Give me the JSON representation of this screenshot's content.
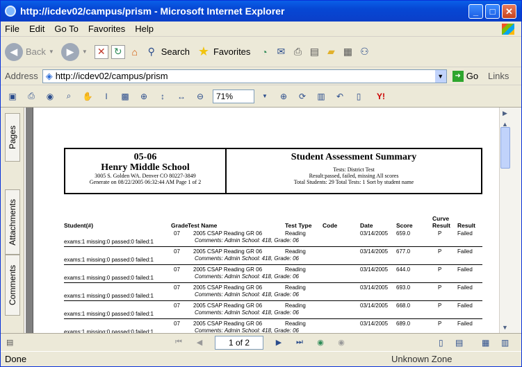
{
  "window": {
    "title": "http://icdev02/campus/prism - Microsoft Internet Explorer"
  },
  "menu": [
    "File",
    "Edit",
    "Go To",
    "Favorites",
    "Help"
  ],
  "toolbar": {
    "back": "Back",
    "search": "Search",
    "favorites": "Favorites"
  },
  "address": {
    "label": "Address",
    "url": "http://icdev02/campus/prism",
    "go": "Go",
    "links": "Links"
  },
  "pdf": {
    "zoom": "71%"
  },
  "sidebar": {
    "pages": "Pages",
    "attachments": "Attachments",
    "comments": "Comments"
  },
  "report": {
    "year": "05-06",
    "school": "Henry Middle School",
    "address": "3005 S. Golden WA. Denver CO 80227-3849",
    "generated": "Generate on 08/22/2005 06:32:44 AM   Page 1 of 2",
    "title": "Student Assessment Summary",
    "tests": "Tests:   District Test",
    "result": "Result:passed, failed, missing   All scores",
    "totals": "Total Students: 29    Total Tests: 1    Sort by student name",
    "headers": {
      "student": "Student(#)",
      "grade": "Grade",
      "test": "Test Name",
      "type": "Test Type",
      "code": "Code",
      "date": "Date",
      "score": "Score",
      "curve1": "Curve",
      "curve2": "Result",
      "result": "Result"
    },
    "rows": [
      {
        "grade": "07",
        "test": "2005 CSAP Reading GR 06",
        "type": "Reading",
        "date": "03/14/2005",
        "score": "659.0",
        "curve": "P",
        "result": "Failed",
        "comment": "Comments: Admin School: 418, Grade: 06",
        "exams": "exams:1  missing:0  passed:0  failed:1"
      },
      {
        "grade": "07",
        "test": "2005 CSAP Reading GR 06",
        "type": "Reading",
        "date": "03/14/2005",
        "score": "677.0",
        "curve": "P",
        "result": "Failed",
        "comment": "Comments: Admin School: 418, Grade: 06",
        "exams": "exams:1  missing:0  passed:0  failed:1"
      },
      {
        "grade": "07",
        "test": "2005 CSAP Reading GR 06",
        "type": "Reading",
        "date": "03/14/2005",
        "score": "644.0",
        "curve": "P",
        "result": "Failed",
        "comment": "Comments: Admin School: 418, Grade: 06",
        "exams": "exams:1  missing:0  passed:0  failed:1"
      },
      {
        "grade": "07",
        "test": "2005 CSAP Reading GR 06",
        "type": "Reading",
        "date": "03/14/2005",
        "score": "693.0",
        "curve": "P",
        "result": "Failed",
        "comment": "Comments: Admin School: 418, Grade: 06",
        "exams": "exams:1  missing:0  passed:0  failed:1"
      },
      {
        "grade": "07",
        "test": "2005 CSAP Reading GR 06",
        "type": "Reading",
        "date": "03/14/2005",
        "score": "668.0",
        "curve": "P",
        "result": "Failed",
        "comment": "Comments: Admin School: 418, Grade: 06",
        "exams": "exams:1  missing:0  passed:0  failed:1"
      },
      {
        "grade": "07",
        "test": "2005 CSAP Reading GR 06",
        "type": "Reading",
        "date": "03/14/2005",
        "score": "689.0",
        "curve": "P",
        "result": "Failed",
        "comment": "Comments: Admin School: 418, Grade: 06",
        "exams": "exams:1  missing:0  passed:0  failed:1"
      }
    ]
  },
  "nav": {
    "page": "1 of 2"
  },
  "status": {
    "left": "Done",
    "zone": "Unknown Zone"
  }
}
